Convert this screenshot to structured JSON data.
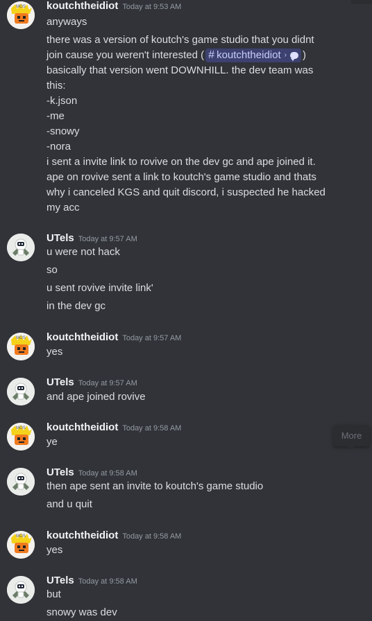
{
  "colors": {
    "background": "#313338",
    "username": "#f2f3f5",
    "timestamp": "#949ba4",
    "text": "#dbdee1",
    "mention_bg": "#3c4270",
    "mention_text": "#c9cdfb"
  },
  "tooltip": {
    "label": "More"
  },
  "messages": [
    {
      "author": "koutchtheidiot",
      "avatar": "koutch-avatar",
      "timestamp": "Today at 9:53 AM",
      "lines": [
        "anyways",
        "there was a version of koutch's game studio that you didnt",
        "join cause you weren't interested (",
        "basically that version went DOWNHILL. the dev team was",
        "this:",
        "-k.json",
        "-me",
        "-snowy",
        "-nora",
        "i sent a invite link to rovive on the dev gc and ape joined it.",
        "ape on rovive sent a link to koutch's game studio and thats",
        "why i canceled KGS and quit discord, i suspected he hacked",
        "my acc"
      ],
      "mention": {
        "label": "koutchtheidiot",
        "after": ")",
        "icon": "thread-bubble-icon"
      }
    },
    {
      "author": "UTels",
      "avatar": "utels-avatar",
      "timestamp": "Today at 9:57 AM",
      "lines": [
        "u were not hack",
        "so",
        "u sent rovive invite link'",
        "in the dev gc"
      ]
    },
    {
      "author": "koutchtheidiot",
      "avatar": "koutch-avatar",
      "timestamp": "Today at 9:57 AM",
      "lines": [
        "yes"
      ]
    },
    {
      "author": "UTels",
      "avatar": "utels-avatar",
      "timestamp": "Today at 9:57 AM",
      "lines": [
        "and ape joined rovive"
      ]
    },
    {
      "author": "koutchtheidiot",
      "avatar": "koutch-avatar",
      "timestamp": "Today at 9:58 AM",
      "lines": [
        "ye"
      ]
    },
    {
      "author": "UTels",
      "avatar": "utels-avatar",
      "timestamp": "Today at 9:58 AM",
      "lines": [
        "then ape sent an invite to koutch's game studio",
        "and u quit"
      ]
    },
    {
      "author": "koutchtheidiot",
      "avatar": "koutch-avatar",
      "timestamp": "Today at 9:58 AM",
      "lines": [
        "yes"
      ]
    },
    {
      "author": "UTels",
      "avatar": "utels-avatar",
      "timestamp": "Today at 9:58 AM",
      "lines": [
        "but",
        "snowy was dev"
      ]
    }
  ]
}
